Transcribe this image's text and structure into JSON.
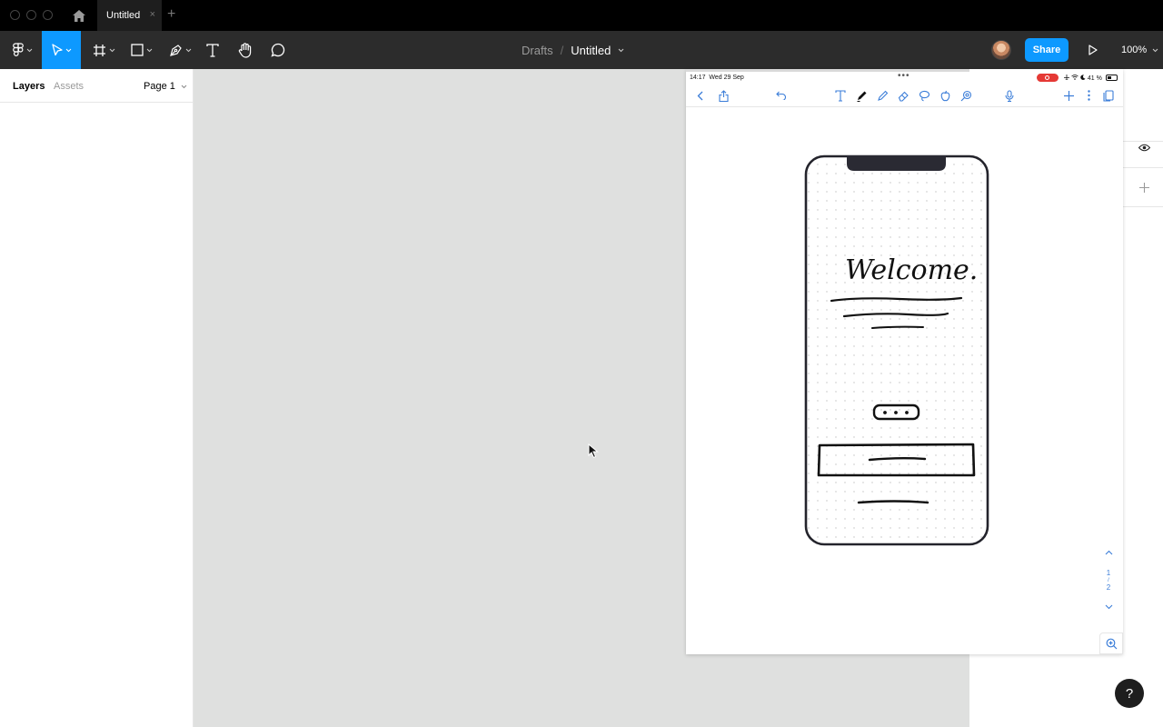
{
  "titlebar": {
    "tab_title": "Untitled",
    "tab_close": "×",
    "tab_add": "+"
  },
  "toolbar": {
    "breadcrumb_parent": "Drafts",
    "breadcrumb_separator": "/",
    "file_name": "Untitled",
    "share_label": "Share",
    "zoom_level": "100%",
    "icons": [
      "figma-menu-icon",
      "move-tool-icon",
      "frame-tool-icon",
      "shape-tool-icon",
      "pen-tool-icon",
      "text-tool-icon",
      "hand-tool-icon",
      "comment-tool-icon",
      "play-icon"
    ]
  },
  "left_panel": {
    "tab_layers": "Layers",
    "tab_assets": "Assets",
    "page_selector": "Page 1"
  },
  "ipad": {
    "time": "14:17",
    "date": "Wed 29 Sep",
    "status_dots": "•••",
    "battery_text": "41 %",
    "page_indicator": [
      "1",
      "/",
      "2"
    ],
    "sketch_text": "Welcome."
  },
  "right_panel": {
    "help_label": "?"
  },
  "colors": {
    "accent": "#0d99ff",
    "toolbar_bg": "#2c2c2c",
    "canvas_bg": "#dfe0df",
    "recording": "#e53935",
    "ipad_link": "#3b7dd8"
  }
}
